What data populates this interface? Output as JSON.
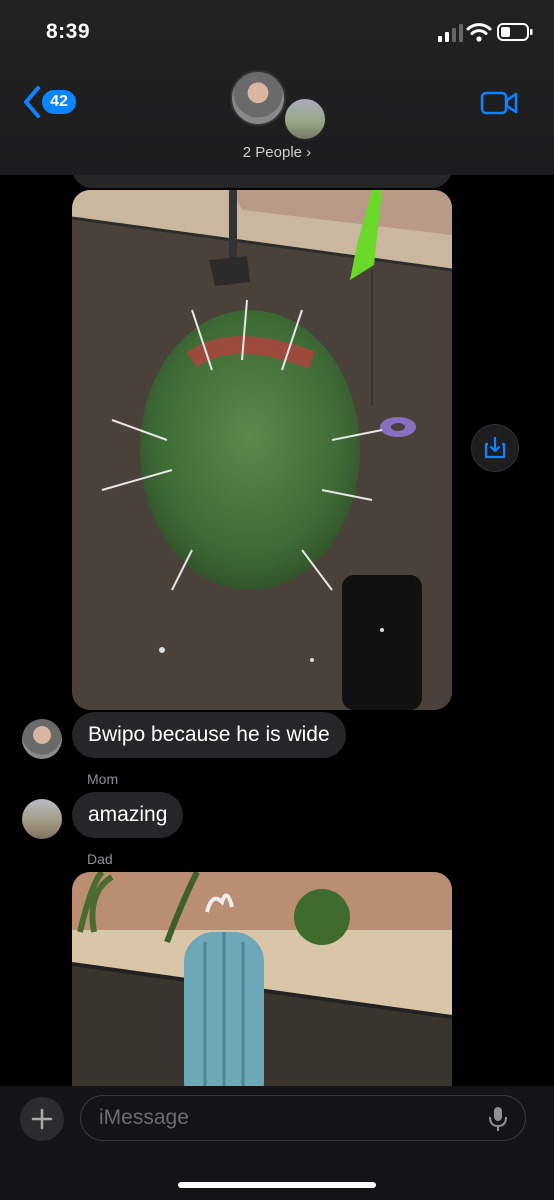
{
  "status_bar": {
    "time": "8:39"
  },
  "header": {
    "back_badge": "42",
    "group_label": "2 People ›"
  },
  "messages": [
    {
      "text": "Bwipo because he is wide"
    },
    {
      "text": "amazing"
    }
  ],
  "senders": {
    "mom": "Mom",
    "dad": "Dad"
  },
  "composer": {
    "placeholder": "iMessage"
  },
  "colors": {
    "accent": "#0a84ff",
    "bubble": "#262628"
  },
  "icons": [
    "back-chevron-icon",
    "video-camera-icon",
    "save-download-icon",
    "plus-icon",
    "microphone-icon",
    "signal-icon",
    "wifi-icon",
    "battery-icon"
  ]
}
